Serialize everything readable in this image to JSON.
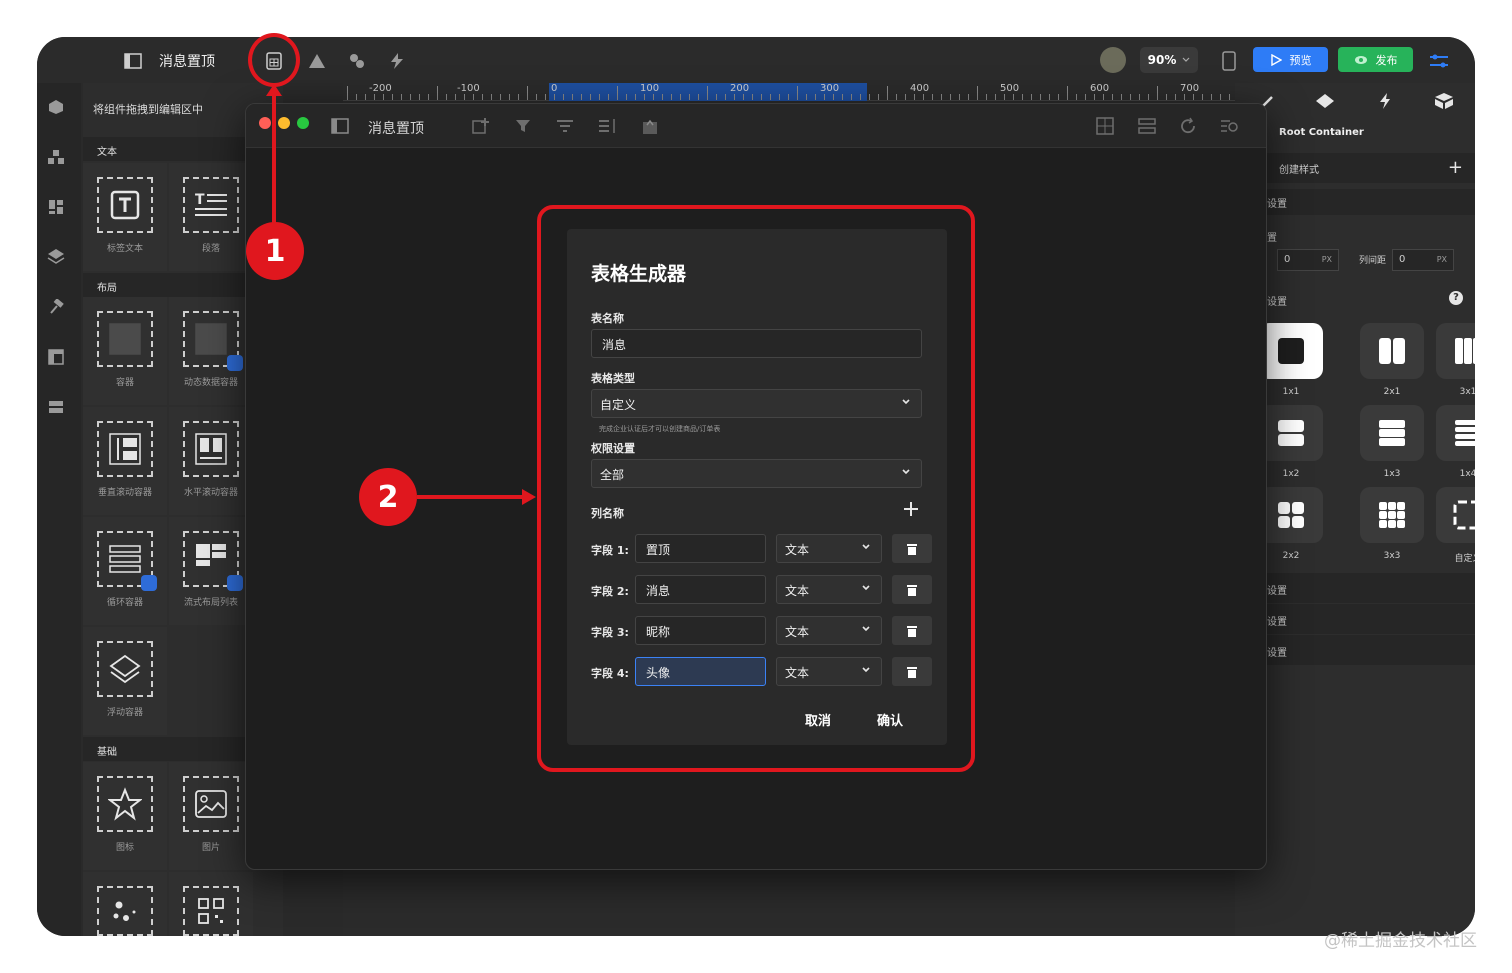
{
  "app": {
    "title": "消息置顶",
    "zoom": "90%",
    "preview_label": "预览",
    "publish_label": "发布"
  },
  "ruler": {
    "labels": [
      "-200",
      "-100",
      "0",
      "100",
      "200",
      "300",
      "400",
      "500",
      "600",
      "700"
    ]
  },
  "components": {
    "hint": "将组件拖拽到编辑区中",
    "sections": {
      "text": "文本",
      "layout": "布局",
      "basic": "基础"
    },
    "items": {
      "label_text": "标签文本",
      "paragraph": "段落",
      "container": "容器",
      "dynamic_container": "动态数据容器",
      "vscroll": "垂直滚动容器",
      "hscroll": "水平滚动容器",
      "loop": "循环容器",
      "flow": "流式布局列表",
      "float": "浮动容器",
      "icon": "图标",
      "image": "图片"
    }
  },
  "props": {
    "root": "Root Container",
    "create_style": "创建样式",
    "settings_1": "设置",
    "settings_2": "置",
    "settings_3": "设置",
    "input_a": "0",
    "unit_a": "PX",
    "col_gap_label": "列间距",
    "input_b": "0",
    "unit_b": "PX",
    "grid": [
      "1x1",
      "2x1",
      "3x1",
      "1x2",
      "1x3",
      "1x4",
      "2x2",
      "3x3",
      "自定义"
    ],
    "sub_1": "设置",
    "sub_2": "设置",
    "sub_3": "设置"
  },
  "window": {
    "title": "消息置顶"
  },
  "dialog": {
    "title": "表格生成器",
    "table_name_label": "表名称",
    "table_name_value": "消息",
    "table_type_label": "表格类型",
    "table_type_value": "自定义",
    "table_type_hint": "完成企业认证后才可以创建商品/订单表",
    "permission_label": "权限设置",
    "permission_value": "全部",
    "columns_label": "列名称",
    "fields": [
      {
        "label": "字段 1:",
        "name": "置顶",
        "type": "文本"
      },
      {
        "label": "字段 2:",
        "name": "消息",
        "type": "文本"
      },
      {
        "label": "字段 3:",
        "name": "昵称",
        "type": "文本"
      },
      {
        "label": "字段 4:",
        "name": "头像",
        "type": "文本"
      }
    ],
    "cancel": "取消",
    "confirm": "确认"
  },
  "annotations": {
    "step1": "1",
    "step2": "2"
  },
  "watermark": "@稀土掘金技术社区",
  "colors": {
    "accent_red": "#e0171e",
    "preview_blue": "#2e7cf6",
    "publish_green": "#27b35a"
  }
}
